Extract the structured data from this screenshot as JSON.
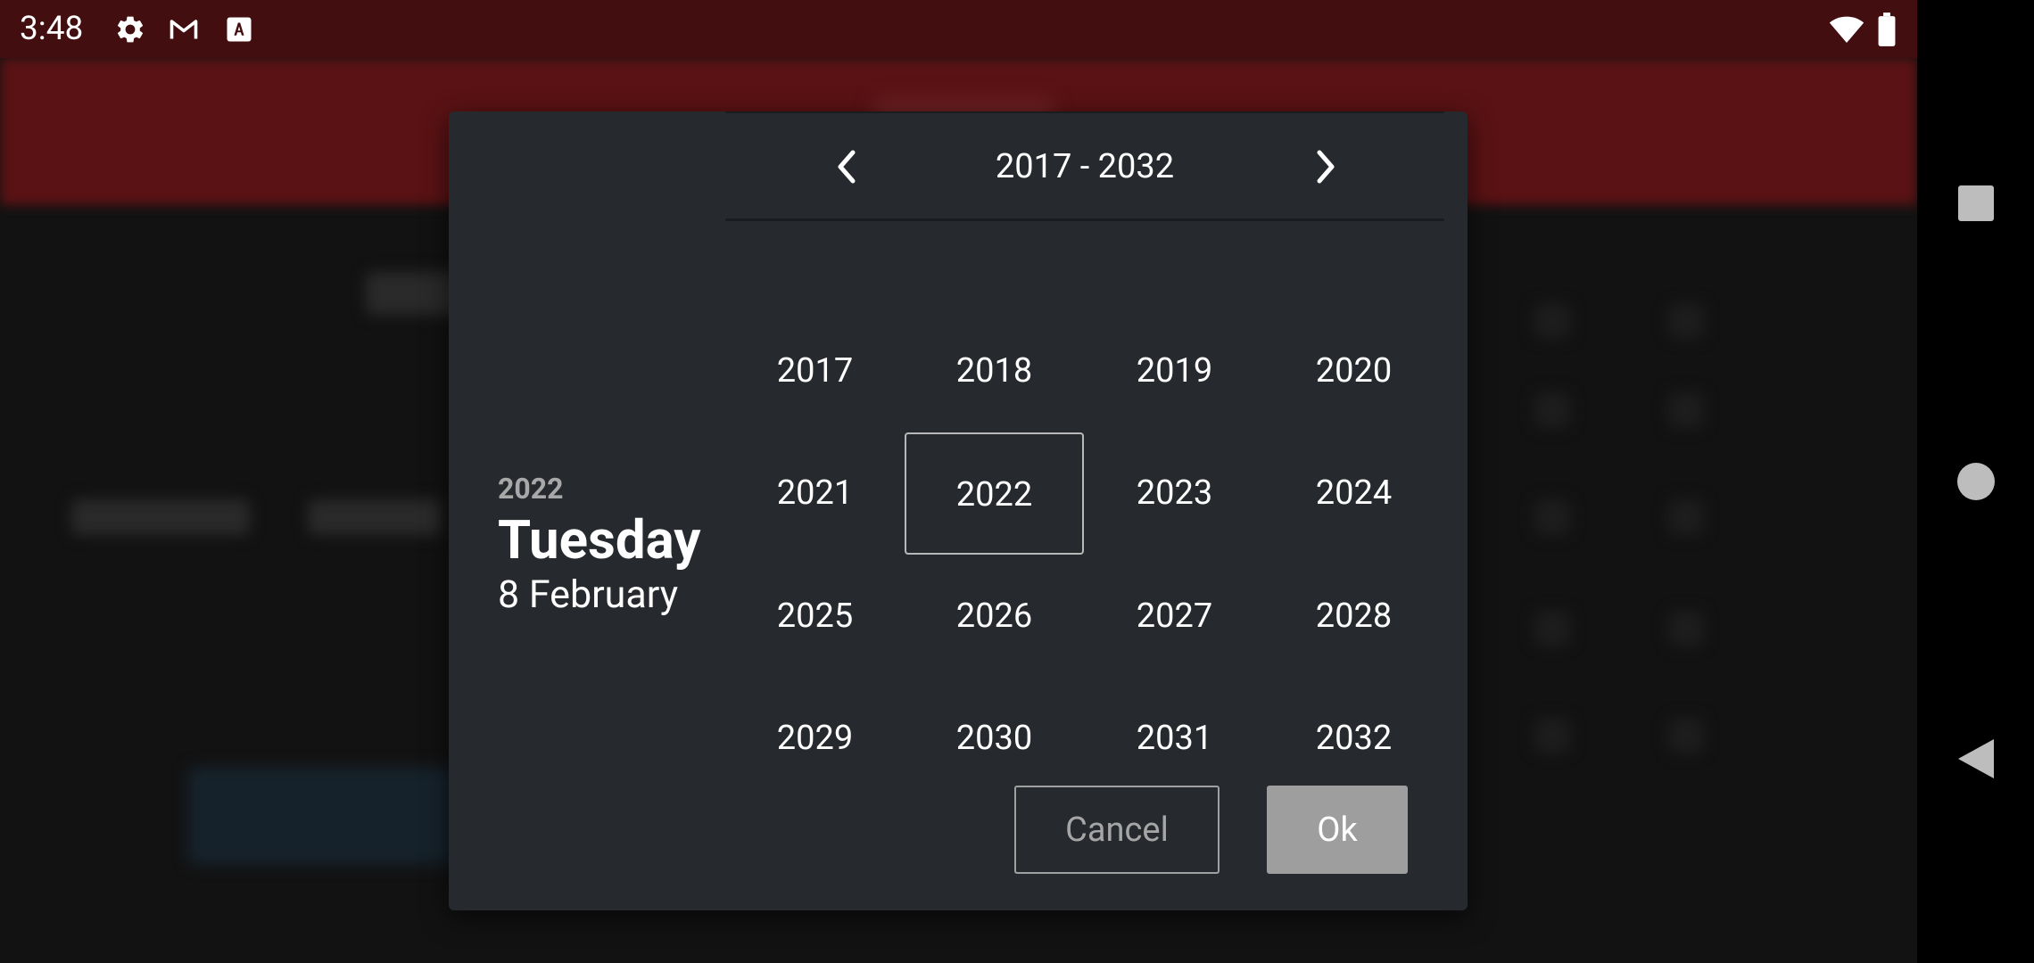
{
  "status_bar": {
    "time": "3:48",
    "icons": [
      "gear-icon",
      "gmail-icon",
      "font-a-icon",
      "wifi-icon",
      "battery-icon"
    ]
  },
  "navigation_bar": {
    "buttons": [
      "recents-square-icon",
      "home-circle-icon",
      "back-triangle-icon"
    ]
  },
  "dialog": {
    "header": {
      "year": "2022",
      "weekday": "Tuesday",
      "date": "8 February"
    },
    "year_picker": {
      "range_label": "2017 - 2032",
      "prev_icon": "chevron-left-icon",
      "next_icon": "chevron-right-icon",
      "years": [
        "2017",
        "2018",
        "2019",
        "2020",
        "2021",
        "2022",
        "2023",
        "2024",
        "2025",
        "2026",
        "2027",
        "2028",
        "2029",
        "2030",
        "2031",
        "2032"
      ],
      "selected_year": "2022"
    },
    "buttons": {
      "cancel_label": "Cancel",
      "ok_label": "Ok"
    }
  },
  "colors": {
    "status_bar_bg": "#420e0f",
    "toolbar_bg": "#5a1214",
    "dialog_bg": "#26292e",
    "ok_button_bg": "#9e9e9e",
    "nav_bar_bg": "#000000"
  }
}
